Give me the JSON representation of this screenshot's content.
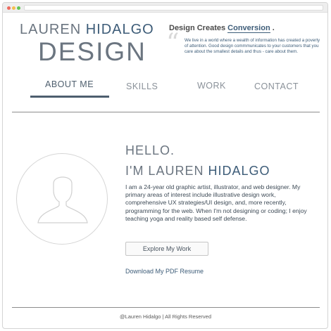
{
  "logo": {
    "name_light": "LAUREN",
    "name_strong": "HIDALGO",
    "word": "DESIGN"
  },
  "tagline": {
    "prefix": "Design Creates",
    "accent": "Conversion",
    "suffix": "."
  },
  "quote": {
    "mark": "“",
    "text": "We live in a world where a wealth of information has created a poverty of attention. Good design commmunicates to your customers that you care about the smallest details and thus - care about them."
  },
  "nav": {
    "about": "ABOUT ME",
    "skills": "SKILLS",
    "work": "WORK",
    "contact": "CONTACT"
  },
  "intro": {
    "hello": "HELLO.",
    "im": "I'M LAUREN",
    "name_strong": "HIDALGO",
    "bio": "I am a 24-year old graphic artist, illustrator, and web designer. My primary areas of interest include illustrative design work, comprehensive UX strategies/UI design, and, more recently, programming for the web. When I'm not designing or coding; I enjoy teaching yoga and reality based self defense."
  },
  "actions": {
    "explore": "Explore My Work",
    "resume": "Download My PDF Resume"
  },
  "footer": {
    "text": "@Lauren Hidalgo | All Rights Reserved"
  },
  "icons": {
    "avatar": "user-silhouette-icon"
  },
  "colors": {
    "accent": "#3d5c78",
    "nav_active": "#4d5e6e",
    "muted": "#8a9199"
  }
}
